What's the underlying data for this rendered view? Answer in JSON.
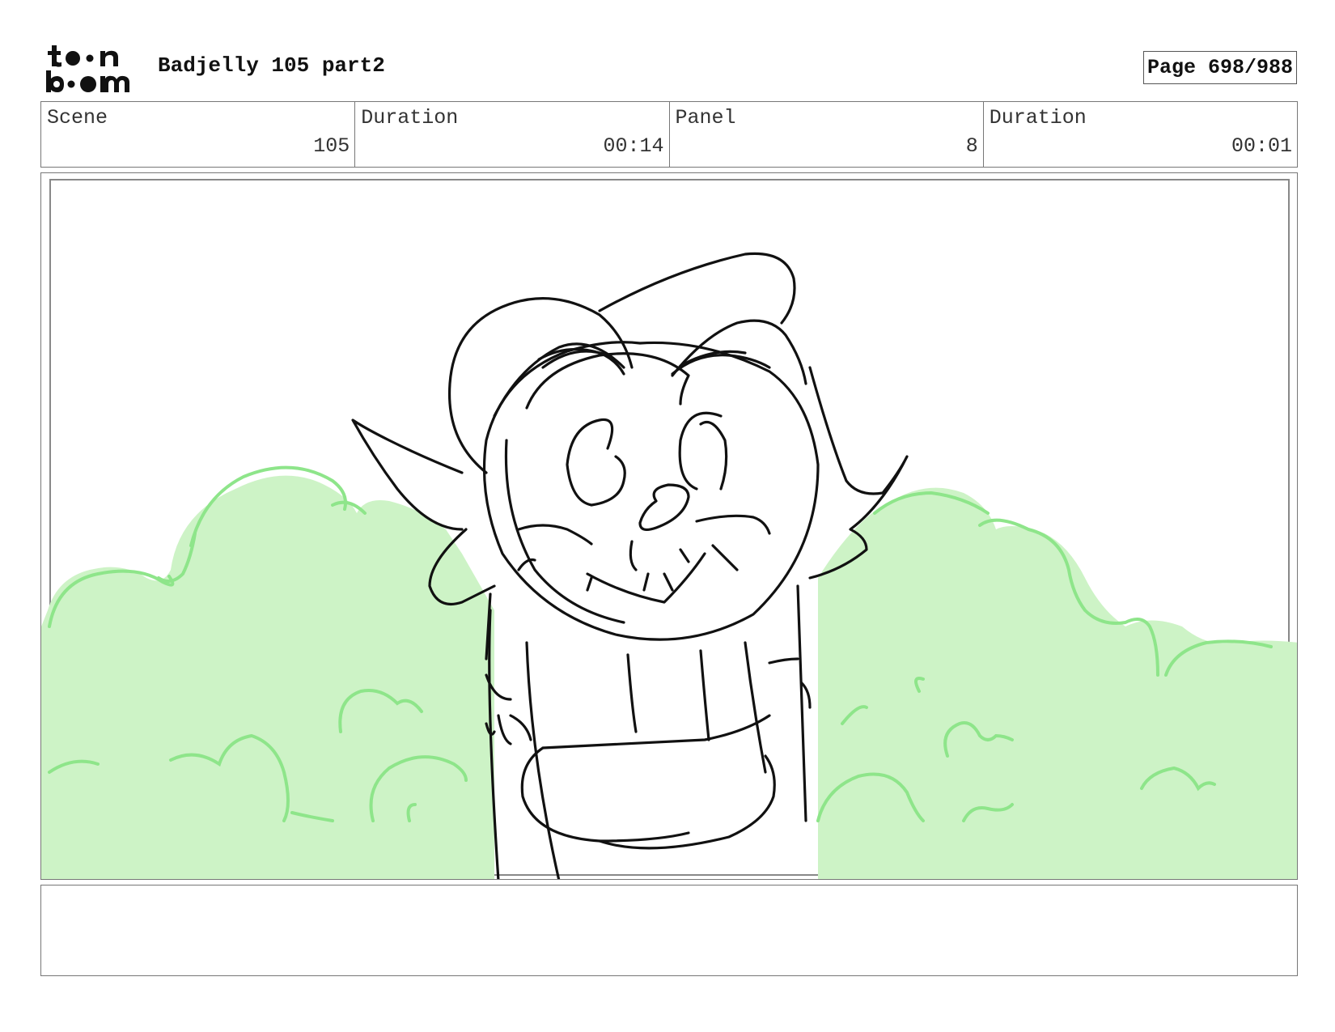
{
  "header": {
    "logo_text_top": "toon",
    "logo_text_bottom": "boom",
    "project_title": "Badjelly 105 part2",
    "page_label": "Page 698/988"
  },
  "info": {
    "scene_label": "Scene",
    "scene_value": "105",
    "scene_duration_label": "Duration",
    "scene_duration_value": "00:14",
    "panel_label": "Panel",
    "panel_value": "8",
    "panel_duration_label": "Duration",
    "panel_duration_value": "00:01"
  },
  "panel": {
    "bush_fill_color": "#cdf3c6",
    "bush_line_color": "#8ee58a",
    "sketch_line_color": "#111111"
  },
  "notes": {
    "text": ""
  }
}
